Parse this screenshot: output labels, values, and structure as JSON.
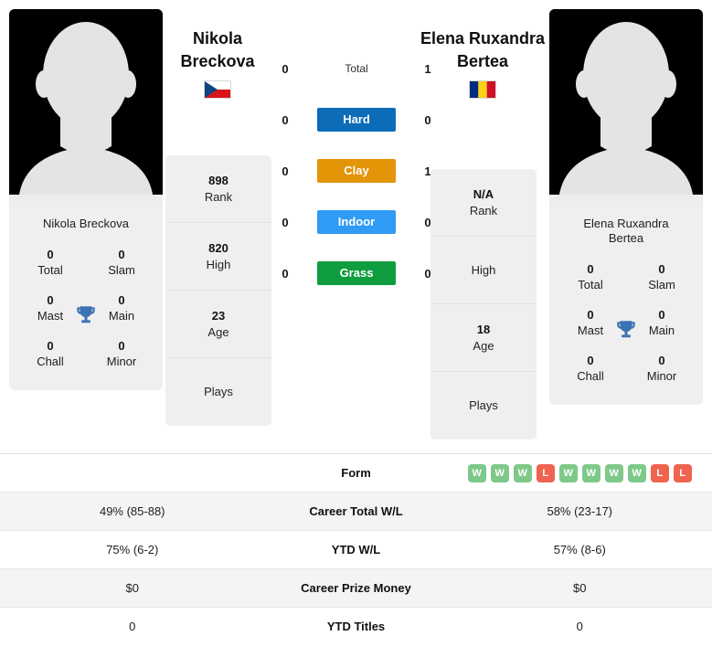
{
  "players": {
    "left": {
      "headline_name": "Nikola\nBreckova",
      "headline_line1": "Nikola",
      "headline_line2": "Breckova",
      "card_name": "Nikola Breckova",
      "flag": "czech-republic-flag",
      "avatar": "player-avatar-placeholder",
      "titles": [
        {
          "num": "0",
          "label": "Total"
        },
        {
          "num": "0",
          "label": "Slam"
        },
        {
          "num": "0",
          "label": "Mast"
        },
        {
          "num": "0",
          "label": "Main"
        },
        {
          "num": "0",
          "label": "Chall"
        },
        {
          "num": "0",
          "label": "Minor"
        }
      ],
      "rank_cells": [
        {
          "value": "898",
          "label": "Rank"
        },
        {
          "value": "820",
          "label": "High"
        },
        {
          "value": "23",
          "label": "Age"
        },
        {
          "value": "",
          "label": "Plays"
        }
      ]
    },
    "right": {
      "headline_line1": "Elena Ruxandra",
      "headline_line2": "Bertea",
      "card_name_line1": "Elena Ruxandra",
      "card_name_line2": "Bertea",
      "flag": "romania-flag",
      "avatar": "player-avatar-placeholder",
      "titles": [
        {
          "num": "0",
          "label": "Total"
        },
        {
          "num": "0",
          "label": "Slam"
        },
        {
          "num": "0",
          "label": "Mast"
        },
        {
          "num": "0",
          "label": "Main"
        },
        {
          "num": "0",
          "label": "Chall"
        },
        {
          "num": "0",
          "label": "Minor"
        }
      ],
      "rank_cells": [
        {
          "value": "N/A",
          "label": "Rank"
        },
        {
          "value": "",
          "label": "High"
        },
        {
          "value": "18",
          "label": "Age"
        },
        {
          "value": "",
          "label": "Plays"
        }
      ]
    }
  },
  "surfaces": [
    {
      "label": "Total",
      "left": "0",
      "right": "1",
      "color": "none",
      "style": "plain"
    },
    {
      "label": "Hard",
      "left": "0",
      "right": "0",
      "color": "#0c6cb8",
      "style": "bar"
    },
    {
      "label": "Clay",
      "left": "0",
      "right": "1",
      "color": "#e39407",
      "style": "bar"
    },
    {
      "label": "Indoor",
      "left": "0",
      "right": "0",
      "color": "#2f9bf5",
      "style": "bar"
    },
    {
      "label": "Grass",
      "left": "0",
      "right": "0",
      "color": "#0f9d3f",
      "style": "bar"
    }
  ],
  "stats_table": {
    "form": {
      "label": "Form",
      "left": "",
      "badges": [
        "W",
        "W",
        "W",
        "L",
        "W",
        "W",
        "W",
        "W",
        "L",
        "L"
      ]
    },
    "rows": [
      {
        "left": "49% (85-88)",
        "label": "Career Total W/L",
        "right": "58% (23-17)"
      },
      {
        "left": "75% (6-2)",
        "label": "YTD W/L",
        "right": "57% (8-6)"
      },
      {
        "left": "$0",
        "label": "Career Prize Money",
        "right": "$0"
      },
      {
        "left": "0",
        "label": "YTD Titles",
        "right": "0"
      }
    ]
  },
  "colors": {
    "hard": "#0c6cb8",
    "clay": "#e39407",
    "indoor": "#2f9bf5",
    "grass": "#0f9d3f",
    "win_badge": "#7ec98a",
    "loss_badge": "#f0634f",
    "panel_bg": "#efefef",
    "trophy": "#3b72b4"
  }
}
